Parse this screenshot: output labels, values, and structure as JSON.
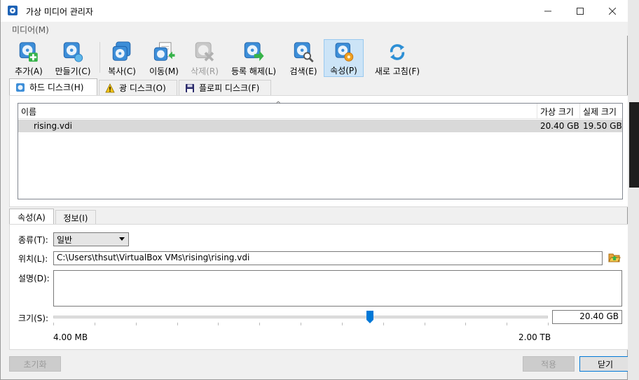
{
  "window": {
    "title": "가상 미디어 관리자"
  },
  "menu": {
    "media": "미디어(M)"
  },
  "toolbar": {
    "add": "추가(A)",
    "create": "만들기(C)",
    "copy": "복사(C)",
    "move": "이동(M)",
    "remove": "삭제(R)",
    "release": "등록 해제(L)",
    "search": "검색(E)",
    "properties": "속성(P)",
    "refresh": "새로 고침(F)"
  },
  "media_tabs": {
    "hard_disk": "하드 디스크(H)",
    "optical_disk": "광 디스크(O)",
    "floppy_disk": "플로피 디스크(F)"
  },
  "table": {
    "columns": {
      "name": "이름",
      "virtual_size": "가상 크기",
      "actual_size": "실제 크기"
    },
    "rows": [
      {
        "name": "rising.vdi",
        "virtual_size": "20.40 GB",
        "actual_size": "19.50 GB"
      }
    ]
  },
  "detail_tabs": {
    "attributes": "속성(A)",
    "information": "정보(I)"
  },
  "attributes": {
    "type_label": "종류(T):",
    "type_value": "일반",
    "location_label": "위치(L):",
    "location_value": "C:\\Users\\thsut\\VirtualBox VMs\\rising\\rising.vdi",
    "description_label": "설명(D):",
    "description_value": "",
    "size_label": "크기(S):",
    "size_value": "20.40 GB",
    "size_slider_fraction": 0.64,
    "size_min": "4.00 MB",
    "size_max": "2.00 TB"
  },
  "buttons": {
    "reset": "초기화",
    "apply": "적용",
    "close": "닫기"
  },
  "colors": {
    "accent": "#0078d7",
    "selected_row": "#d9d9d9",
    "active_tool": "#cce4f7"
  }
}
